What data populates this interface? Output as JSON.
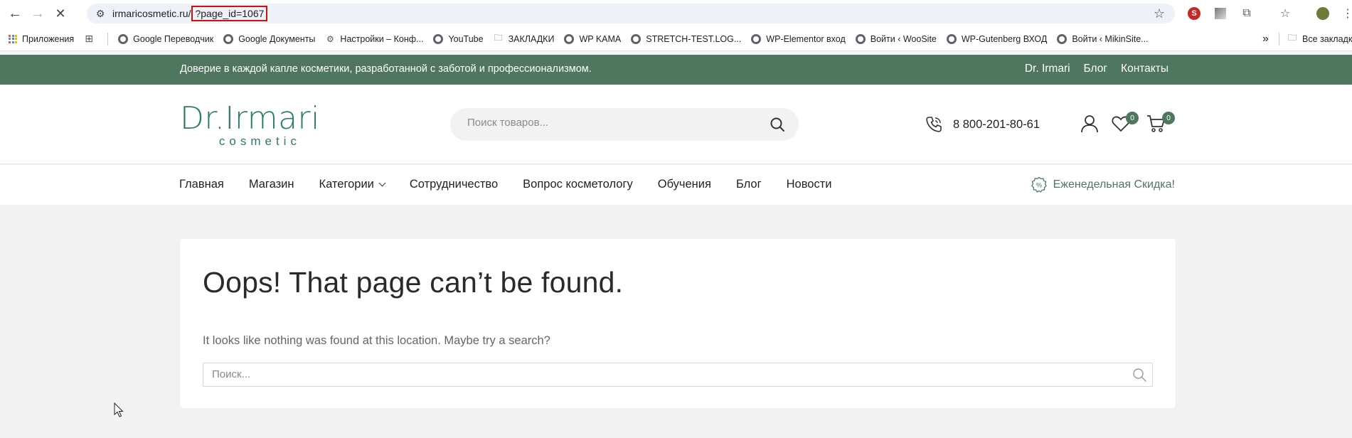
{
  "browser": {
    "url_host": "irmaricosmetic.ru/",
    "url_path": "?page_id=1067",
    "bookmarks": [
      {
        "label": "Приложения",
        "icon": "apps-grid-icon"
      },
      {
        "label": "Google Переводчик",
        "icon": "globe-icon"
      },
      {
        "label": "Google Документы",
        "icon": "globe-icon"
      },
      {
        "label": "Настройки – Конф...",
        "icon": "gear-icon"
      },
      {
        "label": "YouTube",
        "icon": "globe-icon"
      },
      {
        "label": "ЗАКЛАДКИ",
        "icon": "folder-icon"
      },
      {
        "label": "WP KAMA",
        "icon": "globe-icon"
      },
      {
        "label": "STRETCH-TEST.LOG...",
        "icon": "globe-icon"
      },
      {
        "label": "WP-Elementor вход",
        "icon": "globe-icon"
      },
      {
        "label": "Войти ‹ WooSite",
        "icon": "globe-icon"
      },
      {
        "label": "WP-Gutenberg ВХОД",
        "icon": "globe-icon"
      },
      {
        "label": "Войти ‹ MikinSite...",
        "icon": "globe-icon"
      }
    ],
    "more_bookmarks": "»",
    "all_bookmarks": "Все закладки"
  },
  "site": {
    "topbar": {
      "message": "Доверие в каждой капле косметики, разработанной с заботой и профессионализмом.",
      "links": [
        "Dr. Irmari",
        "Блог",
        "Контакты"
      ]
    },
    "logo": {
      "main": "Dr.Irmari",
      "sub": "cosmetic"
    },
    "search": {
      "placeholder": "Поиск товаров..."
    },
    "phone": "8 800-201-80-61",
    "wishlist_count": "0",
    "cart_count": "0",
    "menu": [
      "Главная",
      "Магазин",
      "Категории",
      "Сотрудничество",
      "Вопрос косметологу",
      "Обучения",
      "Блог",
      "Новости"
    ],
    "weekly_discount": "Еженедельная Скидка!"
  },
  "error": {
    "title": "Oops! That page can’t be found.",
    "text": "It looks like nothing was found at this location. Maybe try a search?",
    "search_placeholder": "Поиск..."
  },
  "colors": {
    "brand": "#4f775f",
    "logo": "#2d7a68",
    "highlight": "#d01010"
  }
}
